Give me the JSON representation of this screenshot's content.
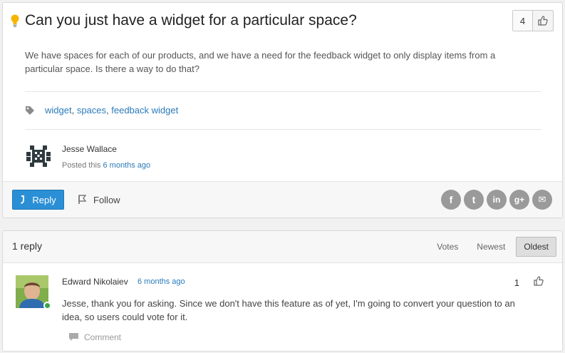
{
  "topic": {
    "title": "Can you just have a widget for a particular space?",
    "icon": "lightbulb-icon",
    "votes": "4",
    "body": "We have spaces for each of our products, and we have a need for the feedback widget to only display items from a particular space. Is there a way to do that?",
    "tags": [
      "widget",
      "spaces",
      "feedback widget"
    ],
    "tag_separator": ", ",
    "author": {
      "name": "Jesse Wallace",
      "posted_prefix": "Posted this ",
      "posted_time": "6 months ago"
    }
  },
  "actions": {
    "reply_label": "Reply",
    "follow_label": "Follow",
    "share": [
      {
        "name": "facebook-share-button",
        "icon": "facebook-icon",
        "glyph": "f"
      },
      {
        "name": "twitter-share-button",
        "icon": "twitter-icon",
        "glyph": "t"
      },
      {
        "name": "linkedin-share-button",
        "icon": "linkedin-icon",
        "glyph": "in"
      },
      {
        "name": "googleplus-share-button",
        "icon": "google-plus-icon",
        "glyph": "g+"
      },
      {
        "name": "email-share-button",
        "icon": "email-icon",
        "glyph": "✉"
      }
    ]
  },
  "replies": {
    "count_label": "1 reply",
    "sort_tabs": [
      {
        "label": "Votes",
        "active": false
      },
      {
        "label": "Newest",
        "active": false
      },
      {
        "label": "Oldest",
        "active": true
      }
    ],
    "items": [
      {
        "author": "Edward Nikolaiev",
        "time": "6 months ago",
        "votes": "1",
        "text": "Jesse, thank you for asking. Since we don't have this feature as of yet, I'm going to convert your question to an idea, so users could vote for it.",
        "comment_label": "Comment"
      }
    ]
  },
  "colors": {
    "accent": "#2b8fd6",
    "link": "#2a7ab9",
    "online": "#39a64b",
    "share_gray": "#9a9a9a"
  }
}
